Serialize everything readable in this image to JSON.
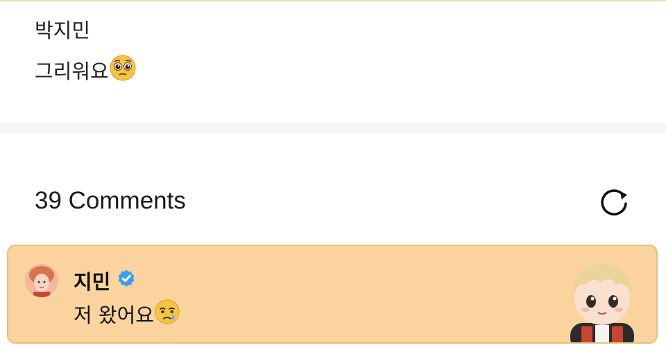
{
  "post": {
    "author": "박지민",
    "body": "그리워요"
  },
  "comments": {
    "count_label": "39 Comments"
  },
  "pinned_comment": {
    "author": "지민",
    "text": "저 왔어요"
  },
  "icons": {
    "post_emoji": "pleading-face-icon",
    "comment_emoji": "crying-face-icon",
    "verified": "verified-badge-icon",
    "refresh": "refresh-icon"
  },
  "colors": {
    "pinned_background": "#fad39e",
    "pinned_border": "#e3c17b",
    "verified_blue": "#3d9bf0",
    "separator": "#f4f5f9"
  }
}
